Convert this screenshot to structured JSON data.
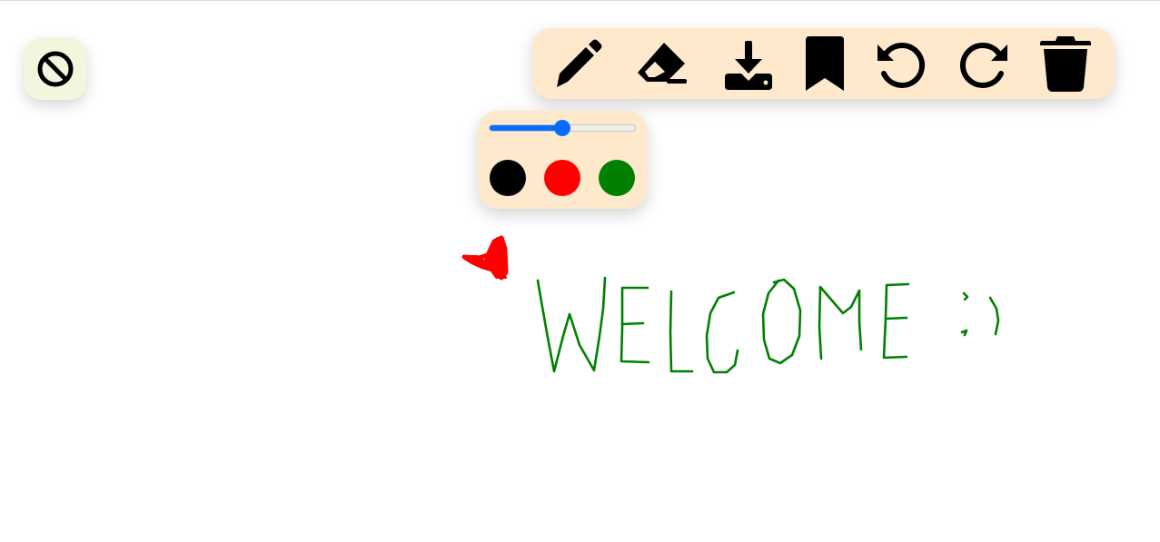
{
  "theme": {
    "panel_color": "#ffe9cd",
    "toggle_color": "#f3f6dd",
    "icon_color": "#000000"
  },
  "cursor_toggle": {
    "icon": "no-entry-icon"
  },
  "toolbar": {
    "tools": [
      {
        "id": "pencil",
        "icon": "pencil-icon"
      },
      {
        "id": "eraser",
        "icon": "eraser-icon"
      },
      {
        "id": "download",
        "icon": "download-icon"
      },
      {
        "id": "bookmark",
        "icon": "bookmark-icon"
      },
      {
        "id": "undo",
        "icon": "undo-icon"
      },
      {
        "id": "redo",
        "icon": "redo-icon"
      },
      {
        "id": "clear",
        "icon": "trash-icon"
      }
    ]
  },
  "brush_panel": {
    "size_slider": {
      "min": 0,
      "max": 100,
      "value": 50,
      "accent": "#0a6cff"
    },
    "colors": [
      {
        "name": "black",
        "hex": "#000000"
      },
      {
        "name": "red",
        "hex": "#ff0000"
      },
      {
        "name": "green",
        "hex": "#008000"
      }
    ]
  },
  "canvas": {
    "strokes": [
      {
        "name": "red-scribble",
        "color": "#ff0000"
      },
      {
        "name": "welcome-handwriting",
        "color": "#008000",
        "text": "WELCOME :)"
      }
    ]
  }
}
